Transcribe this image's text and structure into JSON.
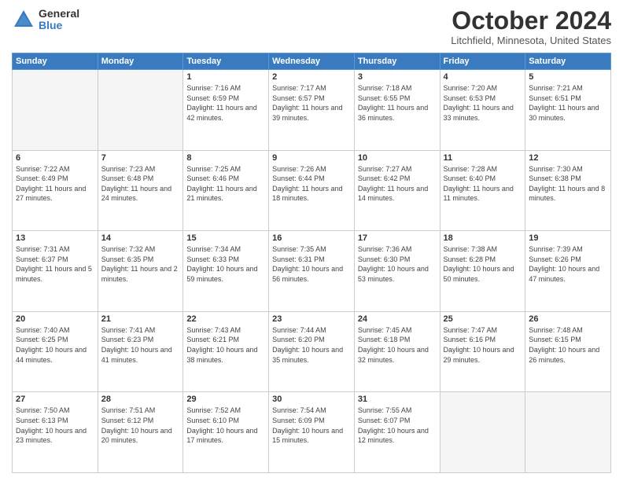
{
  "logo": {
    "general": "General",
    "blue": "Blue"
  },
  "title": "October 2024",
  "location": "Litchfield, Minnesota, United States",
  "weekdays": [
    "Sunday",
    "Monday",
    "Tuesday",
    "Wednesday",
    "Thursday",
    "Friday",
    "Saturday"
  ],
  "weeks": [
    [
      {
        "day": "",
        "empty": true
      },
      {
        "day": "",
        "empty": true
      },
      {
        "day": "1",
        "sunrise": "7:16 AM",
        "sunset": "6:59 PM",
        "daylight": "11 hours and 42 minutes."
      },
      {
        "day": "2",
        "sunrise": "7:17 AM",
        "sunset": "6:57 PM",
        "daylight": "11 hours and 39 minutes."
      },
      {
        "day": "3",
        "sunrise": "7:18 AM",
        "sunset": "6:55 PM",
        "daylight": "11 hours and 36 minutes."
      },
      {
        "day": "4",
        "sunrise": "7:20 AM",
        "sunset": "6:53 PM",
        "daylight": "11 hours and 33 minutes."
      },
      {
        "day": "5",
        "sunrise": "7:21 AM",
        "sunset": "6:51 PM",
        "daylight": "11 hours and 30 minutes."
      }
    ],
    [
      {
        "day": "6",
        "sunrise": "7:22 AM",
        "sunset": "6:49 PM",
        "daylight": "11 hours and 27 minutes."
      },
      {
        "day": "7",
        "sunrise": "7:23 AM",
        "sunset": "6:48 PM",
        "daylight": "11 hours and 24 minutes."
      },
      {
        "day": "8",
        "sunrise": "7:25 AM",
        "sunset": "6:46 PM",
        "daylight": "11 hours and 21 minutes."
      },
      {
        "day": "9",
        "sunrise": "7:26 AM",
        "sunset": "6:44 PM",
        "daylight": "11 hours and 18 minutes."
      },
      {
        "day": "10",
        "sunrise": "7:27 AM",
        "sunset": "6:42 PM",
        "daylight": "11 hours and 14 minutes."
      },
      {
        "day": "11",
        "sunrise": "7:28 AM",
        "sunset": "6:40 PM",
        "daylight": "11 hours and 11 minutes."
      },
      {
        "day": "12",
        "sunrise": "7:30 AM",
        "sunset": "6:38 PM",
        "daylight": "11 hours and 8 minutes."
      }
    ],
    [
      {
        "day": "13",
        "sunrise": "7:31 AM",
        "sunset": "6:37 PM",
        "daylight": "11 hours and 5 minutes."
      },
      {
        "day": "14",
        "sunrise": "7:32 AM",
        "sunset": "6:35 PM",
        "daylight": "11 hours and 2 minutes."
      },
      {
        "day": "15",
        "sunrise": "7:34 AM",
        "sunset": "6:33 PM",
        "daylight": "10 hours and 59 minutes."
      },
      {
        "day": "16",
        "sunrise": "7:35 AM",
        "sunset": "6:31 PM",
        "daylight": "10 hours and 56 minutes."
      },
      {
        "day": "17",
        "sunrise": "7:36 AM",
        "sunset": "6:30 PM",
        "daylight": "10 hours and 53 minutes."
      },
      {
        "day": "18",
        "sunrise": "7:38 AM",
        "sunset": "6:28 PM",
        "daylight": "10 hours and 50 minutes."
      },
      {
        "day": "19",
        "sunrise": "7:39 AM",
        "sunset": "6:26 PM",
        "daylight": "10 hours and 47 minutes."
      }
    ],
    [
      {
        "day": "20",
        "sunrise": "7:40 AM",
        "sunset": "6:25 PM",
        "daylight": "10 hours and 44 minutes."
      },
      {
        "day": "21",
        "sunrise": "7:41 AM",
        "sunset": "6:23 PM",
        "daylight": "10 hours and 41 minutes."
      },
      {
        "day": "22",
        "sunrise": "7:43 AM",
        "sunset": "6:21 PM",
        "daylight": "10 hours and 38 minutes."
      },
      {
        "day": "23",
        "sunrise": "7:44 AM",
        "sunset": "6:20 PM",
        "daylight": "10 hours and 35 minutes."
      },
      {
        "day": "24",
        "sunrise": "7:45 AM",
        "sunset": "6:18 PM",
        "daylight": "10 hours and 32 minutes."
      },
      {
        "day": "25",
        "sunrise": "7:47 AM",
        "sunset": "6:16 PM",
        "daylight": "10 hours and 29 minutes."
      },
      {
        "day": "26",
        "sunrise": "7:48 AM",
        "sunset": "6:15 PM",
        "daylight": "10 hours and 26 minutes."
      }
    ],
    [
      {
        "day": "27",
        "sunrise": "7:50 AM",
        "sunset": "6:13 PM",
        "daylight": "10 hours and 23 minutes."
      },
      {
        "day": "28",
        "sunrise": "7:51 AM",
        "sunset": "6:12 PM",
        "daylight": "10 hours and 20 minutes."
      },
      {
        "day": "29",
        "sunrise": "7:52 AM",
        "sunset": "6:10 PM",
        "daylight": "10 hours and 17 minutes."
      },
      {
        "day": "30",
        "sunrise": "7:54 AM",
        "sunset": "6:09 PM",
        "daylight": "10 hours and 15 minutes."
      },
      {
        "day": "31",
        "sunrise": "7:55 AM",
        "sunset": "6:07 PM",
        "daylight": "10 hours and 12 minutes."
      },
      {
        "day": "",
        "empty": true
      },
      {
        "day": "",
        "empty": true
      }
    ]
  ],
  "labels": {
    "sunrise": "Sunrise:",
    "sunset": "Sunset:",
    "daylight": "Daylight:"
  }
}
